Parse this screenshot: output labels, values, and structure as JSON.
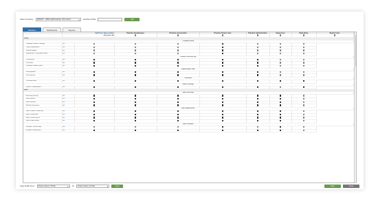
{
  "topbar": {
    "company_label": "Select Company:",
    "company_value": "IMP9870 - IMINU Watchstander CIS Limited",
    "new_profile_label": "Add New Profile",
    "add_button": "Add"
  },
  "tabs": [
    {
      "label": "Modules",
      "active": true
    },
    {
      "label": "Dashboards",
      "active": false
    },
    {
      "label": "Reports",
      "active": false
    }
  ],
  "grid": {
    "header": {
      "edit_col": "Edit User Type Labels",
      "columns": [
        "Practice Bookkeeper",
        "Practice Accountant",
        "Practice Power User",
        "Practice Administrator",
        "Supervisor",
        "Data Entry",
        "Report User"
      ]
    },
    "select_all_label": "[Un] Select All",
    "edit_link": "Edit",
    "rows": [
      {
        "type": "section",
        "label": "Setup"
      },
      {
        "type": "sub",
        "label": "Company Setup"
      },
      {
        "type": "item",
        "label": "Company Details & Settings",
        "checks": [
          0,
          0,
          0,
          1,
          0,
          0,
          0
        ]
      },
      {
        "type": "item",
        "label": "Codes Maintenance",
        "checks": [
          0,
          0,
          0,
          1,
          0,
          0,
          0
        ]
      },
      {
        "type": "item",
        "label": "Default Settings",
        "checks": [
          0,
          0,
          0,
          1,
          0,
          0,
          0
        ]
      },
      {
        "type": "item",
        "label": "Maintenance Transaction Setup",
        "checks": [
          0,
          0,
          0,
          1,
          0,
          0,
          0
        ]
      },
      {
        "type": "sub",
        "label": "Period & Year End Pgl"
      },
      {
        "type": "item",
        "label": "Period Ends",
        "checks": [
          1,
          1,
          1,
          1,
          1,
          0,
          0
        ]
      },
      {
        "type": "item",
        "label": "Year Ends",
        "checks": [
          1,
          1,
          1,
          1,
          1,
          0,
          0
        ]
      },
      {
        "type": "item",
        "label": "Financial Periods Queue",
        "checks": [
          1,
          1,
          1,
          1,
          1,
          0,
          0
        ]
      },
      {
        "type": "sub",
        "label": "Import/Export Data"
      },
      {
        "type": "item",
        "label": "Data Exporter",
        "checks": [
          1,
          1,
          1,
          1,
          1,
          0,
          0
        ]
      },
      {
        "type": "item",
        "label": "Data Importer",
        "checks": [
          1,
          1,
          1,
          1,
          1,
          0,
          0
        ]
      },
      {
        "type": "sub",
        "label": "Password"
      },
      {
        "type": "item",
        "label": "Password reset",
        "checks": [
          1,
          1,
          1,
          1,
          1,
          1,
          1
        ]
      },
      {
        "type": "sub",
        "label": "Report Settings"
      },
      {
        "type": "item",
        "label": "Invoice Customisation",
        "checks": [
          1,
          1,
          1,
          1,
          1,
          0,
          1
        ]
      },
      {
        "type": "section",
        "label": "Sales"
      },
      {
        "type": "sub",
        "label": "Sales Invoicing"
      },
      {
        "type": "item",
        "label": "Recurring Invoices",
        "checks": [
          1,
          1,
          1,
          1,
          1,
          1,
          0
        ]
      },
      {
        "type": "item",
        "label": "New Invoices",
        "checks": [
          1,
          1,
          1,
          1,
          1,
          1,
          0
        ]
      },
      {
        "type": "item",
        "label": "Batch Invoices",
        "checks": [
          1,
          1,
          1,
          1,
          1,
          1,
          0
        ]
      },
      {
        "type": "item",
        "label": "EDI File Generation",
        "checks": [
          1,
          1,
          1,
          1,
          1,
          1,
          0
        ]
      },
      {
        "type": "sub",
        "label": "Sales Adjustments"
      },
      {
        "type": "item",
        "label": "Sales Product Credit Note",
        "checks": [
          1,
          1,
          1,
          1,
          1,
          1,
          0
        ]
      },
      {
        "type": "item",
        "label": "Batch Credit Note",
        "checks": [
          1,
          1,
          1,
          1,
          1,
          1,
          0
        ]
      },
      {
        "type": "item",
        "label": "Sales Credit Journal",
        "checks": [
          1,
          1,
          1,
          1,
          1,
          1,
          0
        ]
      },
      {
        "type": "item",
        "label": "Sales Debit Journal",
        "checks": [
          1,
          1,
          1,
          1,
          1,
          1,
          0
        ]
      },
      {
        "type": "sub",
        "label": "Sales Receipts"
      },
      {
        "type": "item",
        "label": "Receipts / Quick Entry",
        "checks": [
          0,
          0,
          0,
          1,
          0,
          1,
          0
        ]
      },
      {
        "type": "item",
        "label": "Receipts & Allocations",
        "checks": [
          1,
          1,
          1,
          1,
          1,
          1,
          0
        ]
      }
    ]
  },
  "bottombar": {
    "copy_label": "Copy Profile From:",
    "from_placeholder": "Please Select a Profile",
    "to_label": "To:",
    "to_placeholder": "Please Select a Profile",
    "copy_button": "Copy",
    "save_button": "Save",
    "close_button": "Close"
  },
  "colors": {
    "accent": "#2f6fa8",
    "button_green": "#6a9a4e",
    "button_grey": "#777777"
  }
}
